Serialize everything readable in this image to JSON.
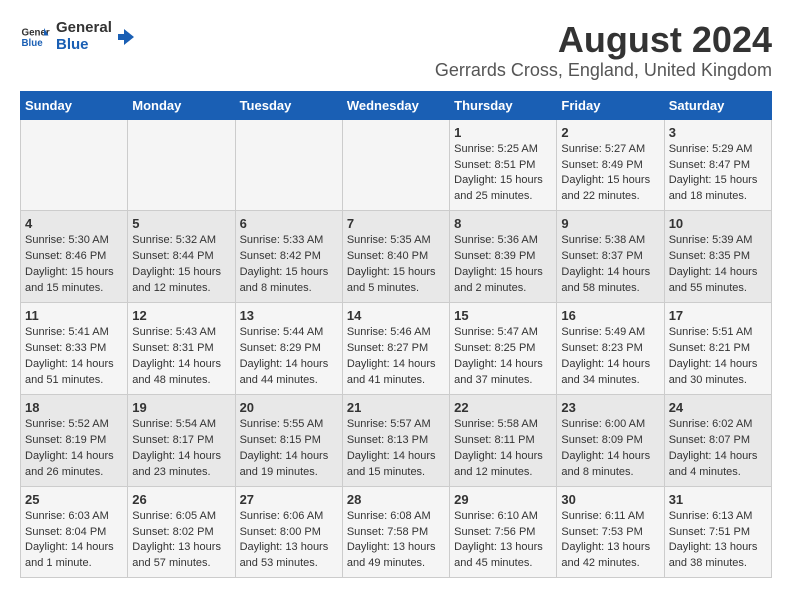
{
  "header": {
    "logo_line1": "General",
    "logo_line2": "Blue",
    "title": "August 2024",
    "subtitle": "Gerrards Cross, England, United Kingdom"
  },
  "calendar": {
    "days_of_week": [
      "Sunday",
      "Monday",
      "Tuesday",
      "Wednesday",
      "Thursday",
      "Friday",
      "Saturday"
    ],
    "weeks": [
      [
        {
          "day": "",
          "content": ""
        },
        {
          "day": "",
          "content": ""
        },
        {
          "day": "",
          "content": ""
        },
        {
          "day": "",
          "content": ""
        },
        {
          "day": "1",
          "content": "Sunrise: 5:25 AM\nSunset: 8:51 PM\nDaylight: 15 hours\nand 25 minutes."
        },
        {
          "day": "2",
          "content": "Sunrise: 5:27 AM\nSunset: 8:49 PM\nDaylight: 15 hours\nand 22 minutes."
        },
        {
          "day": "3",
          "content": "Sunrise: 5:29 AM\nSunset: 8:47 PM\nDaylight: 15 hours\nand 18 minutes."
        }
      ],
      [
        {
          "day": "4",
          "content": "Sunrise: 5:30 AM\nSunset: 8:46 PM\nDaylight: 15 hours\nand 15 minutes."
        },
        {
          "day": "5",
          "content": "Sunrise: 5:32 AM\nSunset: 8:44 PM\nDaylight: 15 hours\nand 12 minutes."
        },
        {
          "day": "6",
          "content": "Sunrise: 5:33 AM\nSunset: 8:42 PM\nDaylight: 15 hours\nand 8 minutes."
        },
        {
          "day": "7",
          "content": "Sunrise: 5:35 AM\nSunset: 8:40 PM\nDaylight: 15 hours\nand 5 minutes."
        },
        {
          "day": "8",
          "content": "Sunrise: 5:36 AM\nSunset: 8:39 PM\nDaylight: 15 hours\nand 2 minutes."
        },
        {
          "day": "9",
          "content": "Sunrise: 5:38 AM\nSunset: 8:37 PM\nDaylight: 14 hours\nand 58 minutes."
        },
        {
          "day": "10",
          "content": "Sunrise: 5:39 AM\nSunset: 8:35 PM\nDaylight: 14 hours\nand 55 minutes."
        }
      ],
      [
        {
          "day": "11",
          "content": "Sunrise: 5:41 AM\nSunset: 8:33 PM\nDaylight: 14 hours\nand 51 minutes."
        },
        {
          "day": "12",
          "content": "Sunrise: 5:43 AM\nSunset: 8:31 PM\nDaylight: 14 hours\nand 48 minutes."
        },
        {
          "day": "13",
          "content": "Sunrise: 5:44 AM\nSunset: 8:29 PM\nDaylight: 14 hours\nand 44 minutes."
        },
        {
          "day": "14",
          "content": "Sunrise: 5:46 AM\nSunset: 8:27 PM\nDaylight: 14 hours\nand 41 minutes."
        },
        {
          "day": "15",
          "content": "Sunrise: 5:47 AM\nSunset: 8:25 PM\nDaylight: 14 hours\nand 37 minutes."
        },
        {
          "day": "16",
          "content": "Sunrise: 5:49 AM\nSunset: 8:23 PM\nDaylight: 14 hours\nand 34 minutes."
        },
        {
          "day": "17",
          "content": "Sunrise: 5:51 AM\nSunset: 8:21 PM\nDaylight: 14 hours\nand 30 minutes."
        }
      ],
      [
        {
          "day": "18",
          "content": "Sunrise: 5:52 AM\nSunset: 8:19 PM\nDaylight: 14 hours\nand 26 minutes."
        },
        {
          "day": "19",
          "content": "Sunrise: 5:54 AM\nSunset: 8:17 PM\nDaylight: 14 hours\nand 23 minutes."
        },
        {
          "day": "20",
          "content": "Sunrise: 5:55 AM\nSunset: 8:15 PM\nDaylight: 14 hours\nand 19 minutes."
        },
        {
          "day": "21",
          "content": "Sunrise: 5:57 AM\nSunset: 8:13 PM\nDaylight: 14 hours\nand 15 minutes."
        },
        {
          "day": "22",
          "content": "Sunrise: 5:58 AM\nSunset: 8:11 PM\nDaylight: 14 hours\nand 12 minutes."
        },
        {
          "day": "23",
          "content": "Sunrise: 6:00 AM\nSunset: 8:09 PM\nDaylight: 14 hours\nand 8 minutes."
        },
        {
          "day": "24",
          "content": "Sunrise: 6:02 AM\nSunset: 8:07 PM\nDaylight: 14 hours\nand 4 minutes."
        }
      ],
      [
        {
          "day": "25",
          "content": "Sunrise: 6:03 AM\nSunset: 8:04 PM\nDaylight: 14 hours\nand 1 minute."
        },
        {
          "day": "26",
          "content": "Sunrise: 6:05 AM\nSunset: 8:02 PM\nDaylight: 13 hours\nand 57 minutes."
        },
        {
          "day": "27",
          "content": "Sunrise: 6:06 AM\nSunset: 8:00 PM\nDaylight: 13 hours\nand 53 minutes."
        },
        {
          "day": "28",
          "content": "Sunrise: 6:08 AM\nSunset: 7:58 PM\nDaylight: 13 hours\nand 49 minutes."
        },
        {
          "day": "29",
          "content": "Sunrise: 6:10 AM\nSunset: 7:56 PM\nDaylight: 13 hours\nand 45 minutes."
        },
        {
          "day": "30",
          "content": "Sunrise: 6:11 AM\nSunset: 7:53 PM\nDaylight: 13 hours\nand 42 minutes."
        },
        {
          "day": "31",
          "content": "Sunrise: 6:13 AM\nSunset: 7:51 PM\nDaylight: 13 hours\nand 38 minutes."
        }
      ]
    ]
  }
}
